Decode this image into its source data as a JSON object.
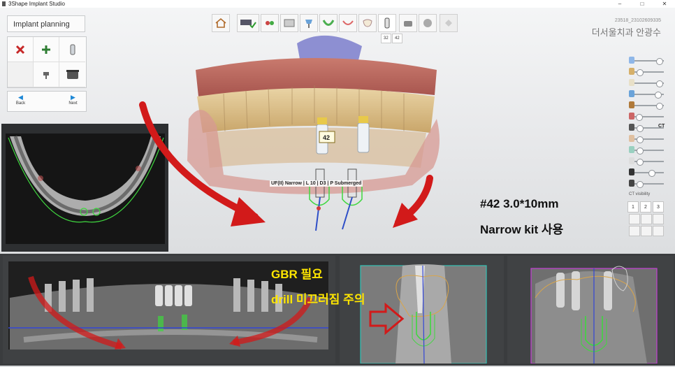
{
  "window": {
    "title": "3Shape Implant Studio",
    "controls": [
      "–",
      "□",
      "✕"
    ]
  },
  "left_panel": {
    "title": "Implant planning",
    "tools": [
      {
        "icon": "delete-x-icon",
        "color": "#c62828"
      },
      {
        "icon": "add-plus-icon",
        "color": "#2e7d32"
      },
      {
        "icon": "implant-icon"
      },
      {
        "icon": "empty-slot"
      },
      {
        "icon": "abutment-icon"
      },
      {
        "icon": "sleeve-icon"
      }
    ],
    "nav": {
      "back": "Back",
      "next": "Next"
    }
  },
  "toolbar": {
    "items": [
      "home-icon",
      "scan-check-icon",
      "tools-icon",
      "panel-icon",
      "tooth-implant-icon",
      "arch-icon",
      "crown-icon",
      "tooth-icon",
      "implant-icon",
      "sleeve-icon",
      "guide-icon",
      "finish-icon"
    ],
    "current_index": 8,
    "chips": [
      "32",
      "42"
    ]
  },
  "patient": {
    "id": "23518_23102609335",
    "name": "더서울치과 안광수"
  },
  "viewer": {
    "implant_label": "UF(II) Narrow | L 10 | D3 | P Submerged",
    "tooth_tag": "42"
  },
  "right_panel": {
    "ct_label": "CT",
    "ct_visibility": "CT visibility",
    "view_buttons": [
      "1",
      "2",
      "3"
    ],
    "sliders": [
      0.9,
      0.1,
      0.9,
      0.85,
      0.9,
      0.05,
      0.1,
      0.1,
      0.1,
      0.1,
      0.6,
      0.1
    ]
  },
  "annotations": {
    "spec": "#42 3.0*10mm",
    "kit": "Narrow kit 사용",
    "gbr": "GBR 필요",
    "drill": "drill 미끄러짐 주의",
    "arrow_color": "#d21a1a",
    "text_color": "#ffe600"
  }
}
